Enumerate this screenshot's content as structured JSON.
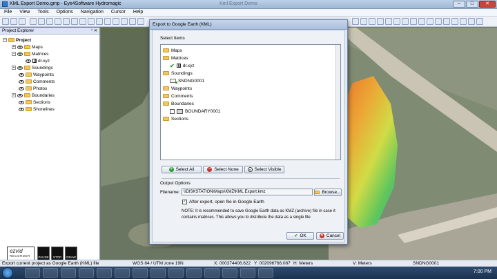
{
  "window": {
    "title": "KML Export Demo.gmp - Eye4Software Hydromagic",
    "ghost_title": "Kml Export Demo"
  },
  "menu": [
    "File",
    "View",
    "Tools",
    "Options",
    "Navigation",
    "Cursor",
    "Help"
  ],
  "explorer": {
    "title": "Project Explorer",
    "root": "Project",
    "nodes": [
      "Maps",
      "Matrices",
      "dr.xyz",
      "Soundings",
      "Waypoints",
      "Comments",
      "Photos",
      "Boundaries",
      "Sections",
      "Shorelines"
    ]
  },
  "dialog": {
    "title": "Export to Google Earth (KML)",
    "select_items_label": "Select Items",
    "items": {
      "maps": "Maps",
      "matrices": "Matrices",
      "matrix_file": "dr.xyz",
      "soundings": "Soundings",
      "sounding_file": "SNDNG0001",
      "waypoints": "Waypoints",
      "comments": "Comments",
      "boundaries": "Boundaries",
      "boundary_file": "BOUNDARY0001",
      "sections": "Sections"
    },
    "buttons": {
      "select_all": "Select All",
      "select_none": "Select None",
      "select_visible": "Select Visible",
      "browse": "Browse...",
      "ok": "OK",
      "cancel": "Cancel"
    },
    "output_options_label": "Output Options",
    "filename_label": "Filename:",
    "filename_value": "\\\\DISKSTATION\\Maps\\KMZ\\KML Export.kmz",
    "open_after_label": "After export, open file in Google Earth",
    "open_after_checked": true,
    "note": "NOTE: It is recommended to save Google Earth data as KMZ (archive) file in case it contains matrices. This allows you to distribute the data as a single file"
  },
  "status": {
    "message": "Export current project as Google Earth (KML) file",
    "crs": "WGS 84 / UTM zone 19N",
    "x": "X: 000374406.622",
    "y": "Y: 002096766.087",
    "h": "H: Meters",
    "v": "V: Meters",
    "sounding": "SNDNG0001"
  },
  "ezvid": {
    "logo": "ezvid",
    "sub": "RECORDER",
    "pause": "PAUSE",
    "stop": "STOP",
    "draw": "DRAW"
  },
  "taskbar": {
    "time": "7:00 PM"
  },
  "colors": {
    "accent": "#2c7bd0",
    "select_all": "#2d9c3a",
    "select_none": "#c9362c"
  }
}
